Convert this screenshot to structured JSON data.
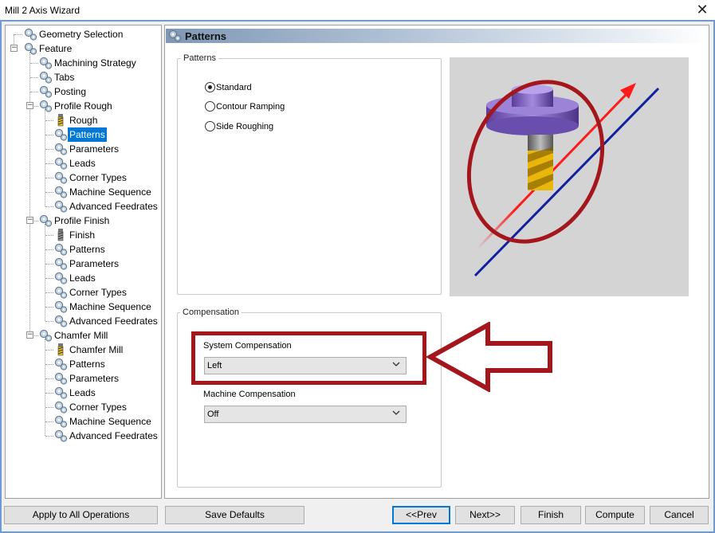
{
  "window": {
    "title": "Mill 2 Axis Wizard"
  },
  "icons": {
    "close": "close-icon",
    "gear": "gear-icon",
    "tool": "end-mill-icon"
  },
  "tree": {
    "items": [
      {
        "label": "Geometry Selection",
        "level": 1,
        "icon": "gear"
      },
      {
        "label": "Feature",
        "level": 0,
        "icon": "gear",
        "expander": "-"
      },
      {
        "label": "Machining Strategy",
        "level": 2,
        "icon": "gear"
      },
      {
        "label": "Tabs",
        "level": 2,
        "icon": "gear"
      },
      {
        "label": "Posting",
        "level": 2,
        "icon": "gear"
      },
      {
        "label": "Profile Rough",
        "level": 2,
        "icon": "gear",
        "expander": "-"
      },
      {
        "label": "Rough",
        "level": 3,
        "icon": "tool-yellow"
      },
      {
        "label": "Patterns",
        "level": 3,
        "icon": "gear",
        "selected": true
      },
      {
        "label": "Parameters",
        "level": 3,
        "icon": "gear"
      },
      {
        "label": "Leads",
        "level": 3,
        "icon": "gear"
      },
      {
        "label": "Corner Types",
        "level": 3,
        "icon": "gear"
      },
      {
        "label": "Machine Sequence",
        "level": 3,
        "icon": "gear"
      },
      {
        "label": "Advanced Feedrates",
        "level": 3,
        "icon": "gear"
      },
      {
        "label": "Profile Finish",
        "level": 2,
        "icon": "gear",
        "expander": "-"
      },
      {
        "label": "Finish",
        "level": 3,
        "icon": "tool-gray"
      },
      {
        "label": "Patterns",
        "level": 3,
        "icon": "gear"
      },
      {
        "label": "Parameters",
        "level": 3,
        "icon": "gear"
      },
      {
        "label": "Leads",
        "level": 3,
        "icon": "gear"
      },
      {
        "label": "Corner Types",
        "level": 3,
        "icon": "gear"
      },
      {
        "label": "Machine Sequence",
        "level": 3,
        "icon": "gear"
      },
      {
        "label": "Advanced Feedrates",
        "level": 3,
        "icon": "gear"
      },
      {
        "label": "Chamfer Mill",
        "level": 2,
        "icon": "gear",
        "expander": "-"
      },
      {
        "label": "Chamfer Mill",
        "level": 3,
        "icon": "tool-yellow"
      },
      {
        "label": "Patterns",
        "level": 3,
        "icon": "gear"
      },
      {
        "label": "Parameters",
        "level": 3,
        "icon": "gear"
      },
      {
        "label": "Leads",
        "level": 3,
        "icon": "gear"
      },
      {
        "label": "Corner Types",
        "level": 3,
        "icon": "gear"
      },
      {
        "label": "Machine Sequence",
        "level": 3,
        "icon": "gear"
      },
      {
        "label": "Advanced Feedrates",
        "level": 3,
        "icon": "gear"
      }
    ]
  },
  "panel": {
    "header": "Patterns",
    "patterns_group": {
      "label": "Patterns",
      "options": [
        "Standard",
        "Contour Ramping",
        "Side Roughing"
      ],
      "selected": "Standard"
    },
    "compensation_group": {
      "label": "Compensation",
      "system_label": "System Compensation",
      "system_value": "Left",
      "machine_label": "Machine Compensation",
      "machine_value": "Off"
    },
    "colors": {
      "highlight_red": "#a4151c",
      "toolpath_red": "#ff1a1a",
      "toolpath_blue": "#1020a0",
      "holder_purple": "#8a66c8",
      "flute_yellow": "#f1c40f"
    }
  },
  "buttons": {
    "apply_all": "Apply to All Operations",
    "save_defaults": "Save Defaults",
    "prev": "<<Prev",
    "next": "Next>>",
    "finish": "Finish",
    "compute": "Compute",
    "cancel": "Cancel"
  }
}
